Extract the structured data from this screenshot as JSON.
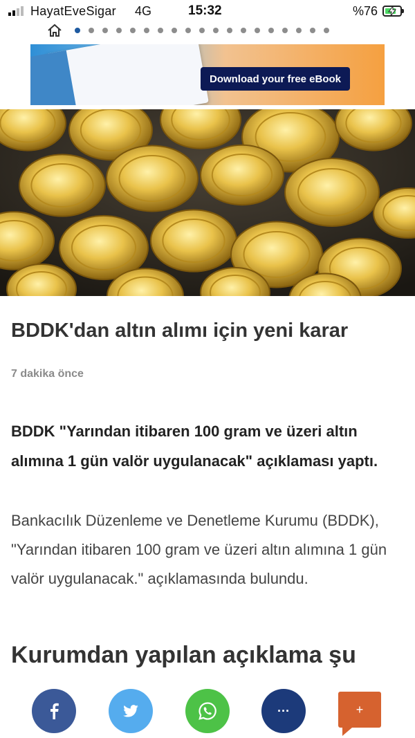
{
  "status_bar": {
    "carrier": "HayatEveSigar",
    "network": "4G",
    "time": "15:32",
    "battery_percent": "%76",
    "battery_level": 0.76
  },
  "pager": {
    "home_icon": "home-icon",
    "page_count": 19,
    "active_index": 0
  },
  "ad": {
    "button_label": "Download your free eBook"
  },
  "article": {
    "hero_image": "gold-coins-photo",
    "title": "BDDK'dan altın alımı için yeni karar",
    "time_ago": "7 dakika önce",
    "lead": "BDDK \"Yarından itibaren 100 gram ve üzeri altın alımına 1 gün valör uygulanacak\" açıklaması yaptı.",
    "body": "Bankacılık Düzenleme ve Denetleme Kurumu (BDDK), \"Yarından itibaren 100 gram ve üzeri altın alımına 1 gün valör uygulanacak.\" açıklamasında bulundu.",
    "subheading": "Kurumdan yapılan açıklama şu"
  },
  "share_bar": {
    "facebook_icon": "facebook-icon",
    "twitter_icon": "twitter-icon",
    "whatsapp_icon": "whatsapp-icon",
    "more_label": "···",
    "add_label": "+",
    "colors": {
      "facebook": "#3b5998",
      "twitter": "#55acee",
      "whatsapp": "#4dc247",
      "more": "#1c3a7a",
      "add": "#d6622f"
    }
  }
}
